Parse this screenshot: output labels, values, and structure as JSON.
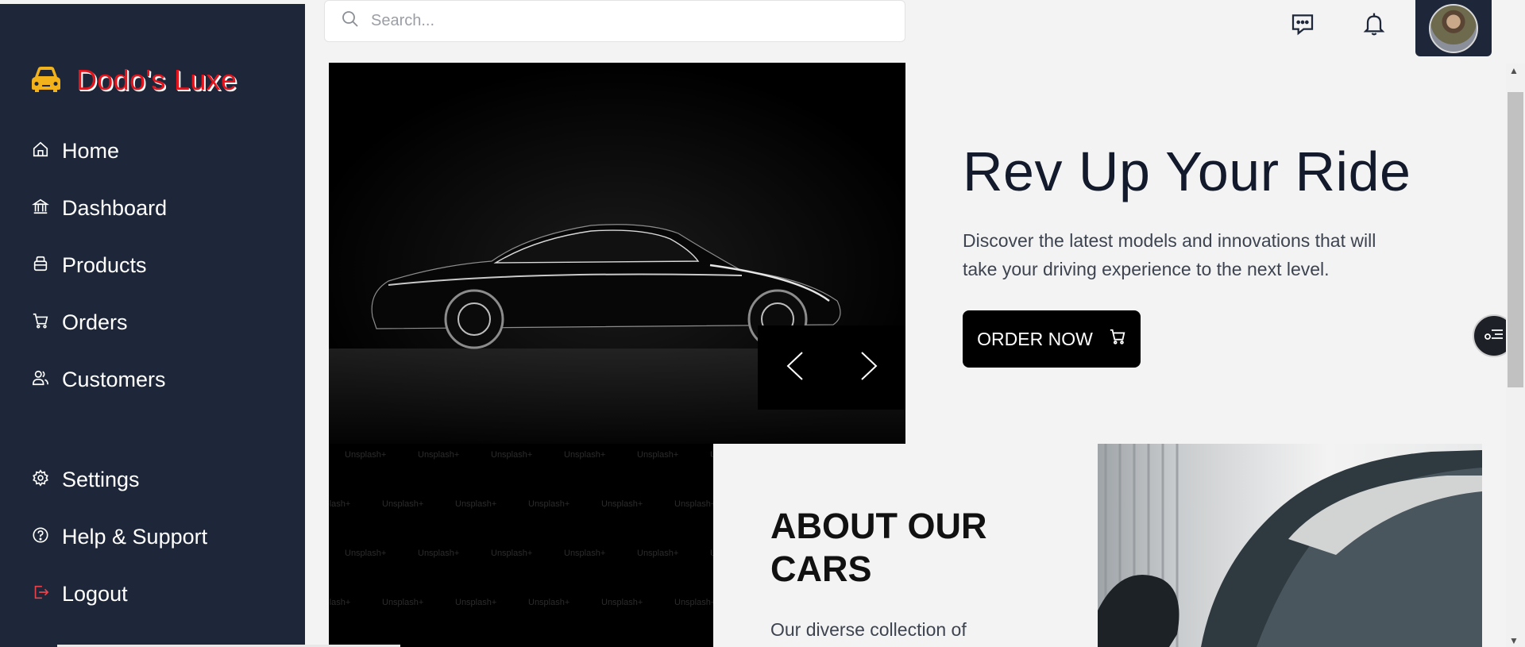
{
  "brand": {
    "name": "Dodo's Luxe"
  },
  "search": {
    "placeholder": "Search..."
  },
  "sidebar": {
    "items": [
      {
        "label": "Home"
      },
      {
        "label": "Dashboard"
      },
      {
        "label": "Products"
      },
      {
        "label": "Orders"
      },
      {
        "label": "Customers"
      }
    ],
    "bottom_items": [
      {
        "label": "Settings"
      },
      {
        "label": "Help & Support"
      },
      {
        "label": "Logout"
      }
    ]
  },
  "hero": {
    "title": "Rev Up Your Ride",
    "text": "Discover the latest models and innovations that will take your driving experience to the next level.",
    "button_label": "ORDER NOW"
  },
  "about": {
    "title": "ABOUT OUR CARS",
    "text": "Our diverse collection of"
  },
  "watermark": "Unsplash+",
  "colors": {
    "sidebar_bg": "#1e2739",
    "brand_red": "#e3141c",
    "brand_icon": "#f2b21b",
    "logout_red": "#e8434a",
    "page_bg": "#f3f3f3",
    "button_bg": "#000000"
  },
  "icons": [
    "car-icon",
    "home-icon",
    "dashboard-icon",
    "products-icon",
    "orders-cart-icon",
    "customers-icon",
    "settings-gear-icon",
    "help-icon",
    "logout-icon",
    "search-icon",
    "chat-icon",
    "bell-icon",
    "cart-icon",
    "chevron-left-icon",
    "chevron-right-icon",
    "menu-toggle-icon"
  ]
}
